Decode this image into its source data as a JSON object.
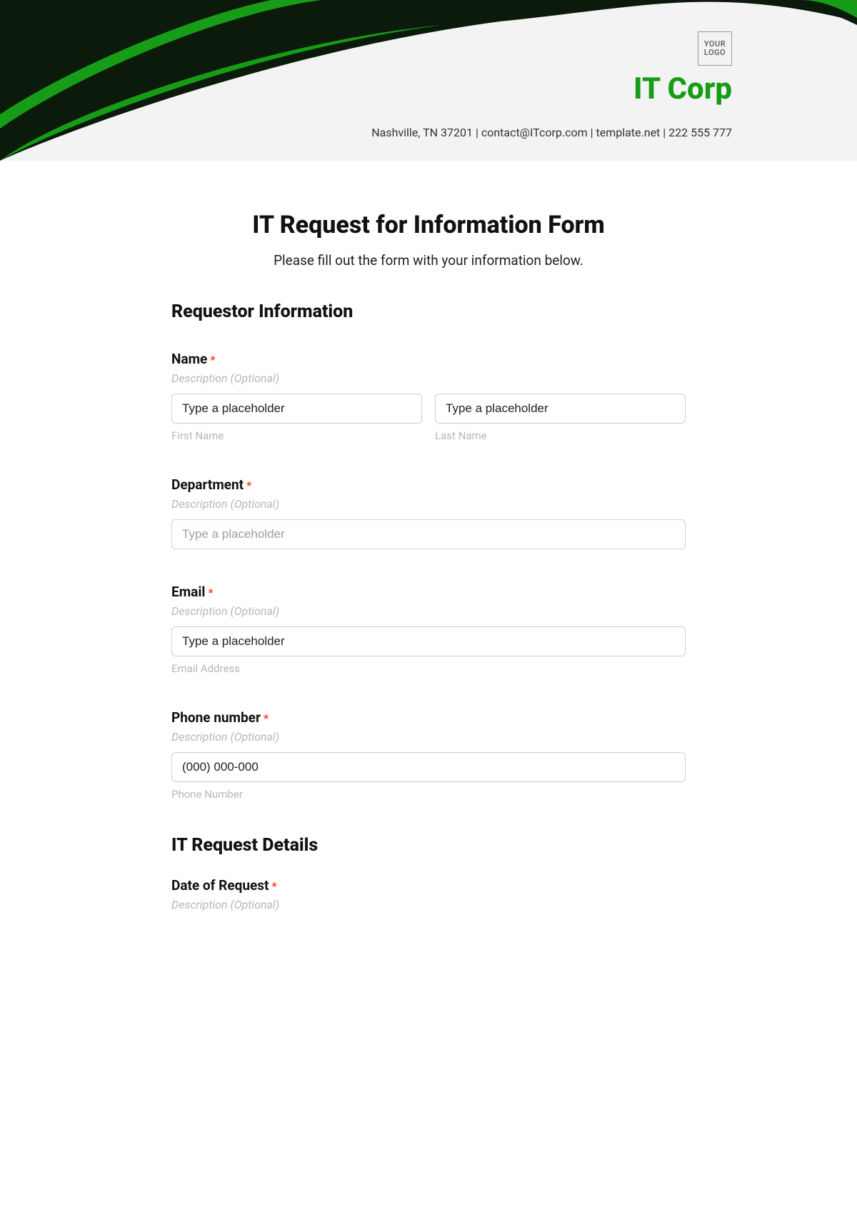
{
  "header": {
    "logo_text": "YOUR LOGO",
    "company_name": "IT Corp",
    "contact_line": "Nashville, TN 37201 | contact@ITcorp.com | template.net | 222 555 777"
  },
  "form": {
    "title": "IT Request for Information Form",
    "subtitle": "Please fill out the form with your information below.",
    "section_requestor": "Requestor Information",
    "section_details": "IT Request Details"
  },
  "fields": {
    "name": {
      "label": "Name",
      "required_mark": "*",
      "desc": "Description (Optional)",
      "first_value": "Type a placeholder",
      "last_value": "Type a placeholder",
      "first_sub": "First Name",
      "last_sub": "Last Name"
    },
    "department": {
      "label": "Department",
      "required_mark": "*",
      "desc": "Description (Optional)",
      "placeholder": "Type a placeholder"
    },
    "email": {
      "label": "Email",
      "required_mark": "*",
      "desc": "Description (Optional)",
      "value": "Type a placeholder",
      "sub": "Email Address"
    },
    "phone": {
      "label": "Phone number",
      "required_mark": "*",
      "desc": "Description (Optional)",
      "value": "(000) 000-000",
      "sub": "Phone Number"
    },
    "date": {
      "label": "Date of Request",
      "required_mark": "*",
      "desc": "Description (Optional)"
    }
  }
}
